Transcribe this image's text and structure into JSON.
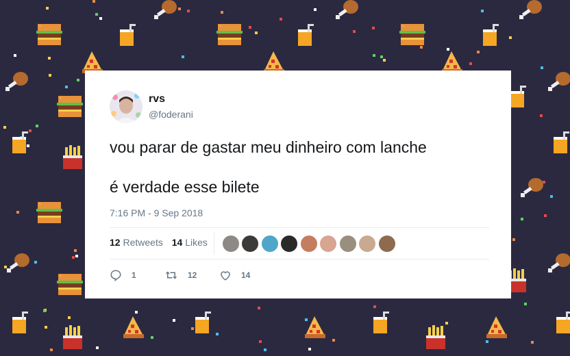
{
  "tweet": {
    "display_name": "rvs",
    "handle": "@foderani",
    "text_line1": "vou parar de gastar meu dinheiro com lanche",
    "text_line2": "é verdade esse bilete",
    "timestamp": "7:16 PM - 9 Sep 2018",
    "retweets_count": "12",
    "retweets_label": "Retweets",
    "likes_count": "14",
    "likes_label": "Likes",
    "replies": "1",
    "retweets_action": "12",
    "likes_action": "14"
  },
  "colors": {
    "background": "#2b2940",
    "card": "#ffffff",
    "text": "#14171a",
    "muted": "#657786"
  },
  "icons": [
    "reply-icon",
    "retweet-icon",
    "like-icon"
  ]
}
